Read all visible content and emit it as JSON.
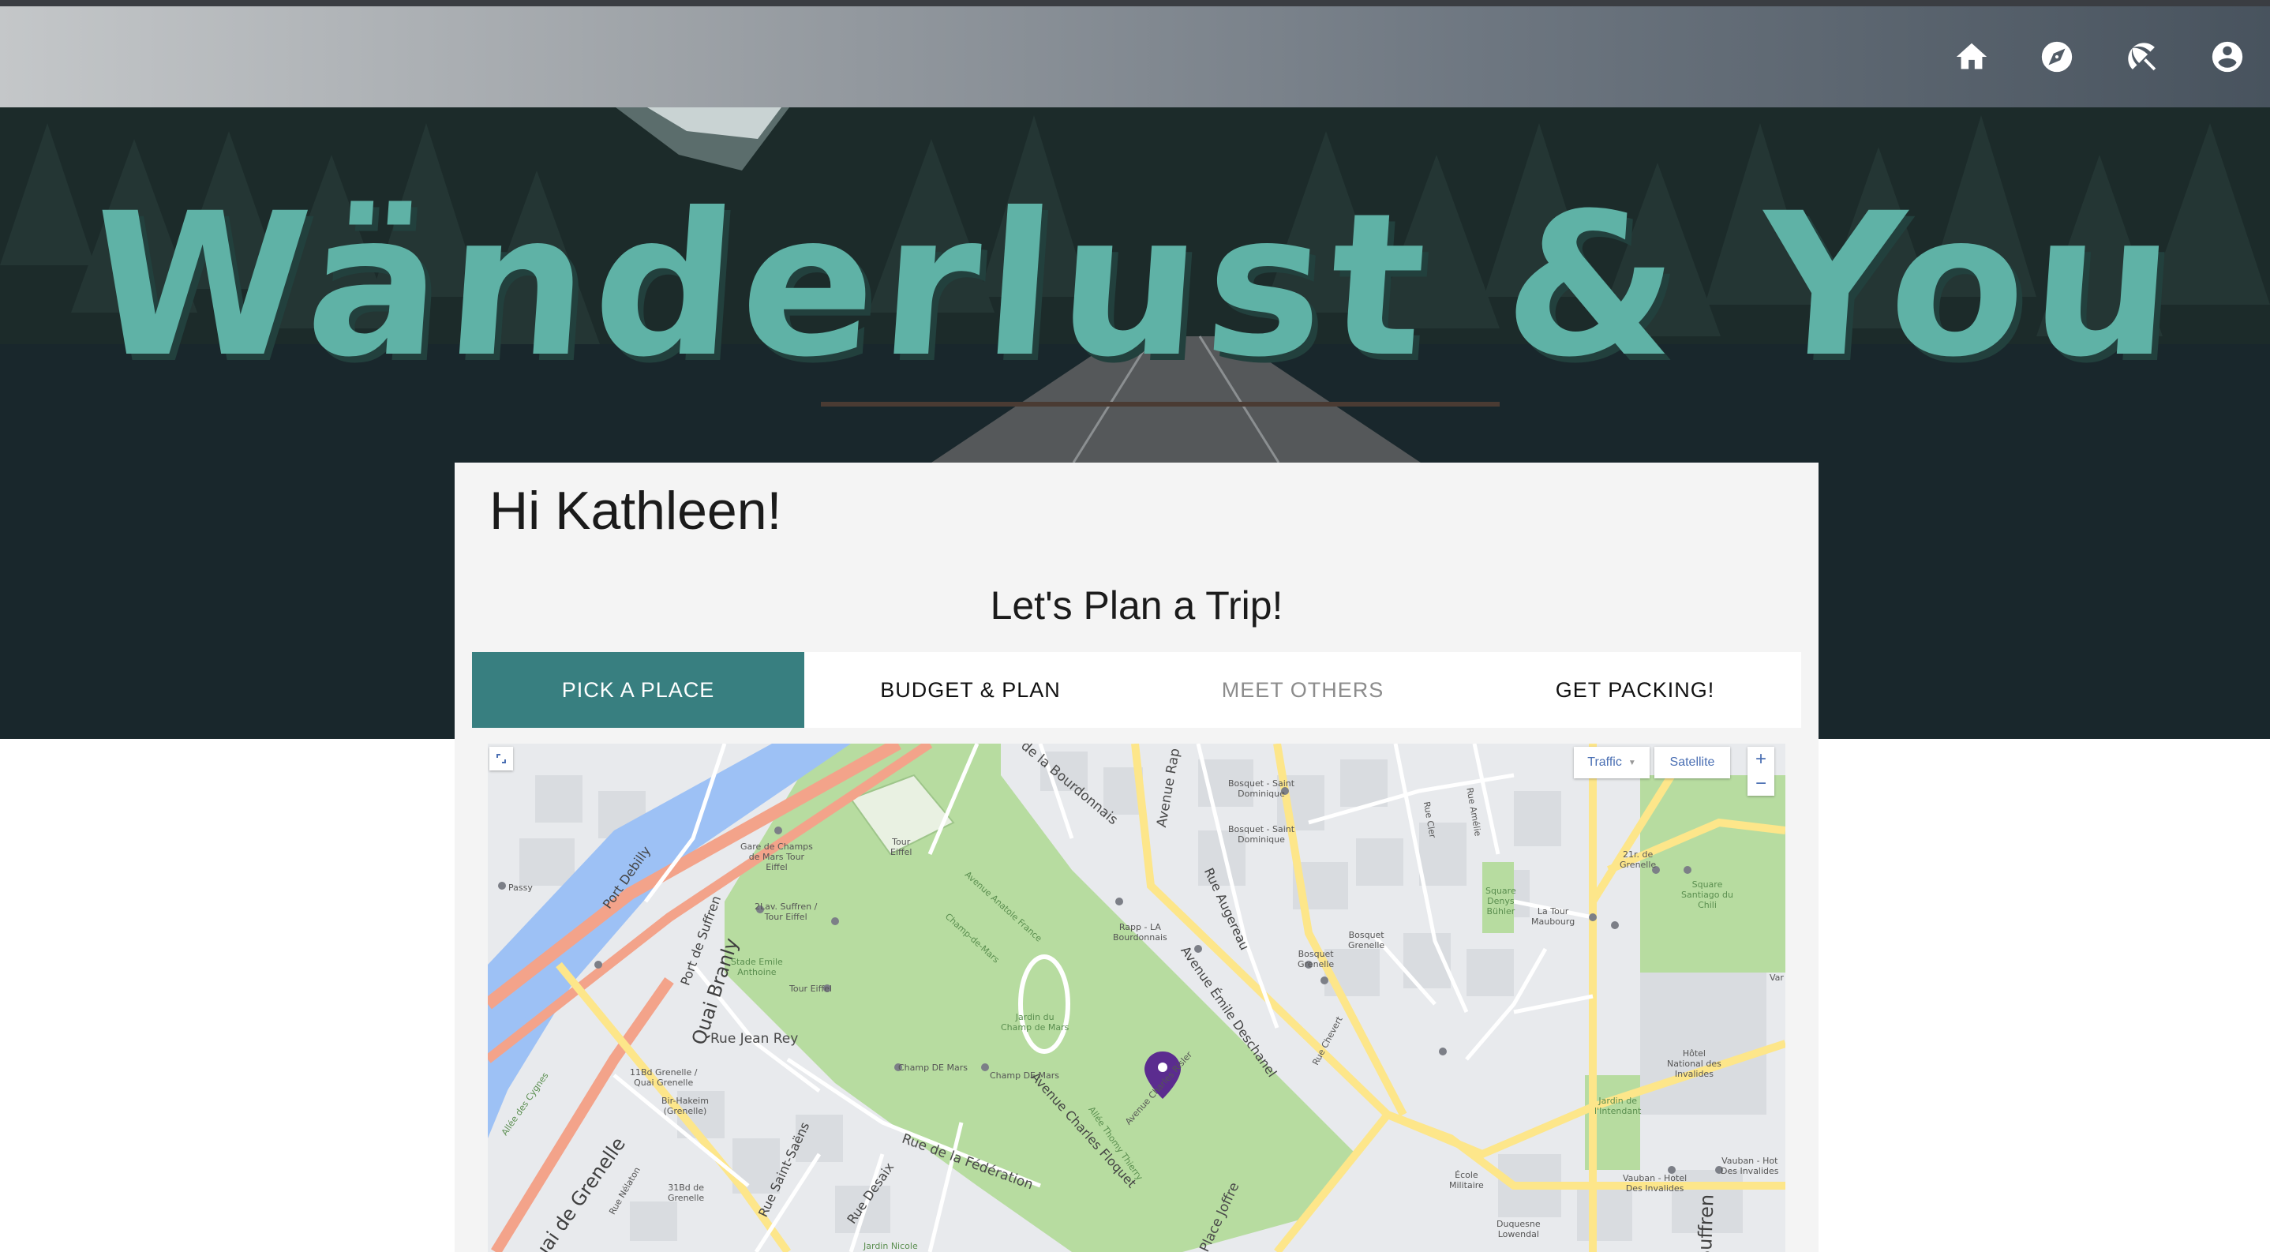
{
  "nav": {
    "icons": [
      "home-icon",
      "compass-icon",
      "beach-umbrella-icon",
      "account-circle-icon"
    ]
  },
  "hero": {
    "title": "Wänderlust & You"
  },
  "card": {
    "greeting": "Hi Kathleen!",
    "subtitle": "Let's Plan a Trip!",
    "tabs": [
      {
        "label": "PICK A PLACE",
        "state": "active"
      },
      {
        "label": "BUDGET & PLAN",
        "state": "normal"
      },
      {
        "label": "MEET OTHERS",
        "state": "muted"
      },
      {
        "label": "GET PACKING!",
        "state": "normal"
      }
    ]
  },
  "map": {
    "controls": {
      "traffic": "Traffic",
      "satellite": "Satellite",
      "zoom_in": "+",
      "zoom_out": "−"
    },
    "labels": {
      "de_la_bourdonnais": "de la Bourdonnais",
      "avenue_rap": "Avenue Rap",
      "rue_cler": "Rue Cler",
      "rue_amelie": "Rue Amélie",
      "port_debilly": "Port Debilly",
      "port_de_suffren": "Port de Suffren",
      "quai_branly": "Quai Branly",
      "rue_jean_rey": "Rue Jean Rey",
      "allee_des_cygnes": "Allée des Cygnes",
      "quai_de_grenelle": "Quai de Grenelle",
      "rue_nelaton": "Rue Nélaton",
      "rue_saint_saens": "Rue Saint-Saëns",
      "rue_desaix": "Rue Desaix",
      "rue_de_la_federation": "Rue de la Fédération",
      "avenue_charles_floquet": "Avenue Charles Floquet",
      "allee_thomy_thierry": "Allée Thomy Thierry",
      "avenue_charles_risler": "Avenue Charles Risler",
      "avenue_anatole_france": "Avenue Anatole France",
      "champ_de_mars_path": "Champ-de-Mars",
      "rue_augereau": "Rue Augereau",
      "avenue_emile_deschanel": "Avenue Émile Deschanel",
      "place_joffre": "Place Joffre",
      "rue_chevert": "Rue Chevert",
      "tour_eiffel": "Tour\nEiffel",
      "gare_champ_de_mars": "Gare de Champs\nde Mars Tour\nEiffel",
      "lav_suffren": "2Lav. Suffren /\nTour Eiffel",
      "stade_emile_anthoine": "Stade Emile\nAnthoine",
      "tour_eiffel_stop": "Tour Eiffel",
      "passy": "Passy",
      "jardin_champ_de_mars": "Jardin du\nChamp de Mars",
      "champ_de_mars_1": "Champ DE Mars",
      "champ_de_mars_2": "Champ DE Mars",
      "bir_hakeim": "Bir-Hakeim\n(Grenelle)",
      "bd_grenelle_1": "11Bd Grenelle /\nQuai Grenelle",
      "bd_grenelle_2": "31Bd de\nGrenelle",
      "rapp_bourdonnais": "Rapp - LA\nBourdonnais",
      "bosquet_dominique_1": "Bosquet - Saint\nDominique",
      "bosquet_dominique_2": "Bosquet - Saint\nDominique",
      "bosquet_grenelle_1": "Bosquet\nGrenelle",
      "bosquet_grenelle_2": "Bosquet\nGrenelle",
      "square_denys_buhler": "Square\nDenys\nBühler",
      "la_tour_maubourg": "La Tour\nMaubourg",
      "square_santiago": "Square\nSantiago du\nChili",
      "bd_grenelle_3": "21r. de\nGrenelle",
      "hotel_invalides": "Hôtel\nNational des\nInvalides",
      "jardin_intendant": "Jardin de\nl'Intendant",
      "ecole_militaire": "École\nMilitaire",
      "vauban_1": "Vauban - Hotel\nDes Invalides",
      "vauban_2": "Vauban - Hot\nDes Invalides",
      "duquesne": "Duquesne\nLowendal",
      "jardin_nicole": "Jardin Nicole",
      "avenue_suffren_bottom": "Suffren",
      "var": "Var"
    }
  },
  "colors": {
    "accent_teal": "#387f80",
    "title_teal": "#5fb2a6",
    "park_green": "#b7dca0",
    "water_blue": "#9dc1f5",
    "highway_orange": "#f3a38a",
    "major_road_yellow": "#fde68a",
    "marker_purple": "#5b2c8f"
  }
}
